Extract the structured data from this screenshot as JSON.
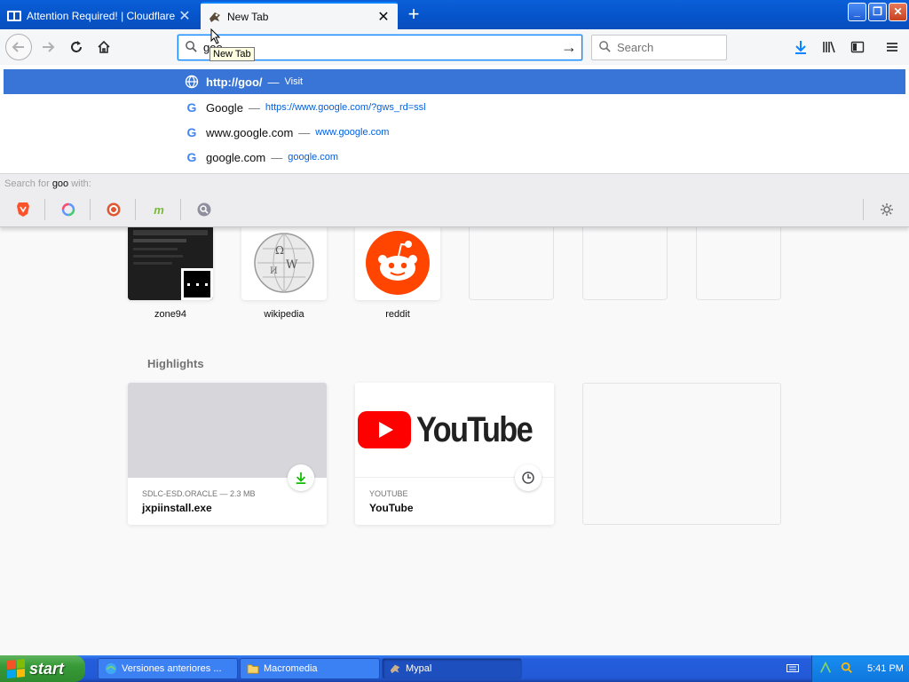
{
  "tabs": [
    {
      "title": "Attention Required! | Cloudflare",
      "favicon": "cloudflare-icon",
      "active": false
    },
    {
      "title": "New Tab",
      "favicon": "mypal-icon",
      "active": true
    }
  ],
  "tooltip": "New Tab",
  "url": {
    "value": "goo"
  },
  "search": {
    "placeholder": "Search"
  },
  "results": [
    {
      "title": "http://goo/",
      "separator": "—",
      "action": "Visit",
      "icon": "globe-icon"
    },
    {
      "title": "Google",
      "separator": "—",
      "url": "https://www.google.com/?gws_rd=ssl",
      "icon": "google-icon"
    },
    {
      "title": "www.google.com",
      "separator": "—",
      "url": "www.google.com",
      "icon": "google-icon"
    },
    {
      "title": "google.com",
      "separator": "—",
      "url": "google.com",
      "icon": "google-icon"
    }
  ],
  "oneoff": {
    "prefix": "Search for",
    "term": "goo",
    "suffix": "with:"
  },
  "engines": [
    "brave-icon",
    "qwant-icon",
    "duckduckgo-icon",
    "mojeek-icon",
    "search-engine-icon"
  ],
  "top_sites": [
    {
      "label": "zone94"
    },
    {
      "label": "wikipedia"
    },
    {
      "label": "reddit"
    }
  ],
  "highlights": {
    "title": "Highlights",
    "cards": [
      {
        "context": "SDLC-ESD.ORACLE — 2.3 MB",
        "title": "jxpiinstall.exe",
        "badge": "download-icon"
      },
      {
        "context": "YOUTUBE",
        "title": "YouTube",
        "badge": "clock-icon",
        "logo_text": "YouTube"
      }
    ]
  },
  "taskbar": {
    "start": "start",
    "tasks": [
      {
        "label": "Versiones anteriores ...",
        "icon": "browser-icon"
      },
      {
        "label": "Macromedia",
        "icon": "folder-icon"
      },
      {
        "label": "Mypal",
        "icon": "mypal-icon"
      }
    ],
    "clock": "5:41 PM"
  },
  "colors": {
    "accent": "#0a84ff",
    "selected_result": "#3875d7",
    "taskbar": "#245edc",
    "start": "#379a37",
    "reddit": "#ff4500",
    "youtube": "#ff0000"
  }
}
